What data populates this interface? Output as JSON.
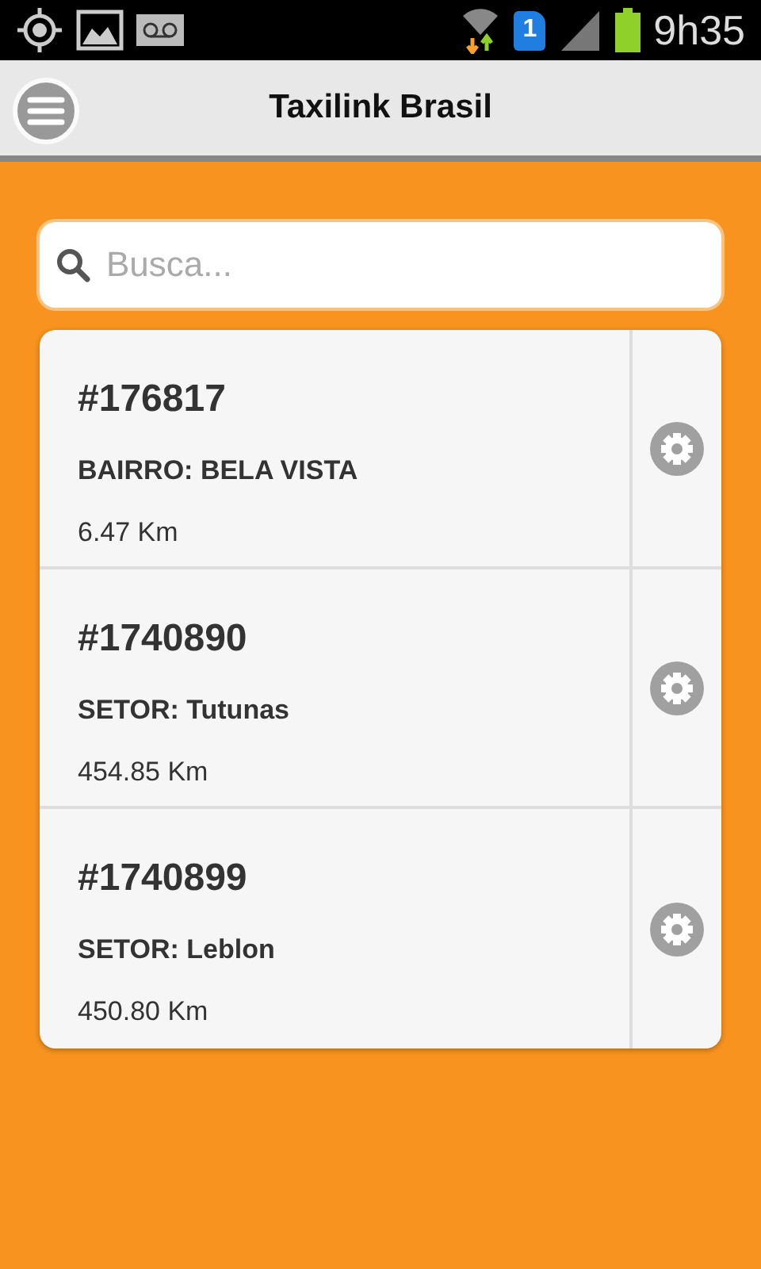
{
  "status_bar": {
    "time": "9h35",
    "sim_slot": "1"
  },
  "header": {
    "title": "Taxilink Brasil"
  },
  "search": {
    "placeholder": "Busca..."
  },
  "rides": [
    {
      "number": "#176817",
      "location": "BAIRRO: BELA VISTA",
      "distance": "6.47 Km"
    },
    {
      "number": "#1740890",
      "location": "SETOR: Tutunas",
      "distance": "454.85 Km"
    },
    {
      "number": "#1740899",
      "location": "SETOR: Leblon",
      "distance": "450.80 Km"
    }
  ]
}
